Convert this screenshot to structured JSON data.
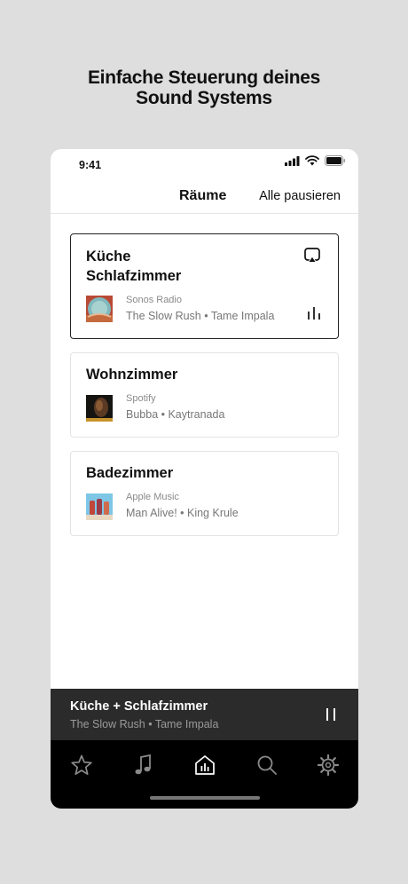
{
  "promo": {
    "headline_line1": "Einfache Steuerung deines",
    "headline_line2": "Sound Systems"
  },
  "status_bar": {
    "time": "9:41"
  },
  "header": {
    "title": "Räume",
    "action": "Alle pausieren"
  },
  "rooms": [
    {
      "name_line1": "Küche",
      "name_line2": "Schlafzimmer",
      "source": "Sonos Radio",
      "track": "The Slow Rush • Tame Impala",
      "active": true,
      "icons": [
        "airplay-icon",
        "equalizer-icon"
      ]
    },
    {
      "name": "Wohnzimmer",
      "source": "Spotify",
      "track": "Bubba • Kaytranada",
      "active": false
    },
    {
      "name": "Badezimmer",
      "source": "Apple Music",
      "track": "Man Alive! • King Krule",
      "active": false
    }
  ],
  "now_playing": {
    "title": "Küche + Schlafzimmer",
    "subtitle": "The Slow Rush • Tame Impala",
    "state_icon": "pause-icon"
  },
  "tab_bar": {
    "tabs": [
      {
        "icon": "star-icon",
        "selected": false
      },
      {
        "icon": "music-note-icon",
        "selected": false
      },
      {
        "icon": "rooms-icon",
        "selected": true
      },
      {
        "icon": "search-icon",
        "selected": false
      },
      {
        "icon": "settings-icon",
        "selected": false
      }
    ]
  },
  "colors": {
    "background": "#dedede",
    "now_playing_bar": "#2b2b2b",
    "tab_bar": "#000000",
    "active_border": "#222222"
  }
}
